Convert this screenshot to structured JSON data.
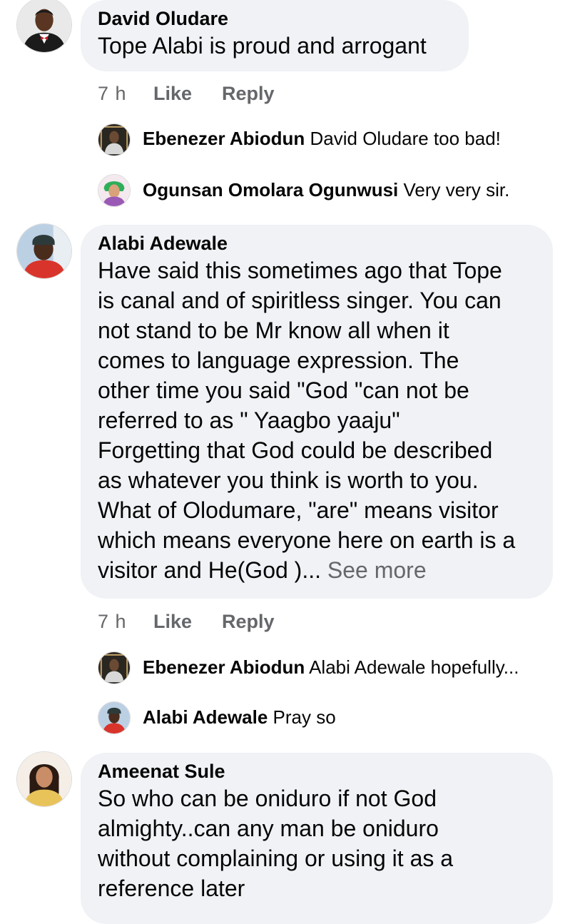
{
  "comments": [
    {
      "author": "David Oludare",
      "text": "Tope Alabi is proud and arrogant",
      "time": "7 h",
      "like_label": "Like",
      "reply_label": "Reply",
      "replies": [
        {
          "author": "Ebenezer Abiodun",
          "text": "David Oludare too bad!"
        },
        {
          "author": "Ogunsan Omolara Ogunwusi",
          "text": "Very very sir."
        }
      ]
    },
    {
      "author": "Alabi Adewale",
      "lines": [
        "Have said this sometimes ago that Tope",
        "is canal and of spiritless singer. You can",
        "not stand to be Mr know all when it",
        "comes to language expression. The",
        "other time you said \"God \"can not be",
        "referred to as \" Yaagbo yaaju\"",
        "Forgetting that God could be described",
        "as whatever you think is worth to you.",
        "What of Olodumare, \"are\" means visitor",
        "which means everyone here on earth is a",
        "visitor and He(God )..."
      ],
      "see_more": "See more",
      "time": "7 h",
      "like_label": "Like",
      "reply_label": "Reply",
      "replies": [
        {
          "author": "Ebenezer Abiodun",
          "text": "Alabi Adewale hopefully..."
        },
        {
          "author": "Alabi Adewale",
          "text": "Pray so"
        }
      ]
    },
    {
      "author": "Ameenat Sule",
      "lines": [
        "So who can be oniduro if not God",
        "almighty..can any man be oniduro",
        "without complaining or using it as a",
        "reference later"
      ]
    }
  ],
  "colors": {
    "bubble": "#f0f2f5",
    "muted": "#65676b",
    "text": "#050505"
  }
}
